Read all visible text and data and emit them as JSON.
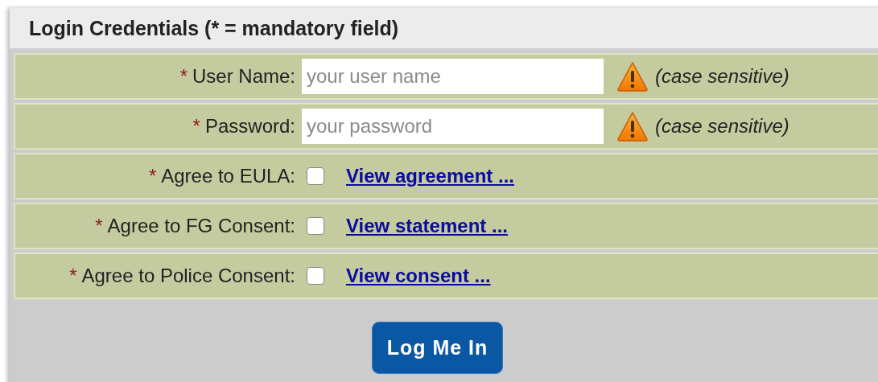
{
  "panel": {
    "title": "Login Credentials (* = mandatory field)"
  },
  "rows": [
    {
      "kind": "text",
      "required_mark": "*",
      "label": "User Name:",
      "placeholder": "your user name",
      "warning": true,
      "note": "(case sensitive)"
    },
    {
      "kind": "text",
      "required_mark": "*",
      "label": "Password:",
      "placeholder": "your password",
      "warning": true,
      "note": "(case sensitive)"
    },
    {
      "kind": "checkbox",
      "required_mark": "*",
      "label": "Agree to EULA:",
      "checked": false,
      "link": "View agreement ..."
    },
    {
      "kind": "checkbox",
      "required_mark": "*",
      "label": "Agree to FG Consent:",
      "checked": false,
      "link": "View statement ..."
    },
    {
      "kind": "checkbox",
      "required_mark": "*",
      "label": "Agree to Police Consent:",
      "checked": false,
      "link": "View consent ..."
    }
  ],
  "button": {
    "label": "Log Me In"
  }
}
